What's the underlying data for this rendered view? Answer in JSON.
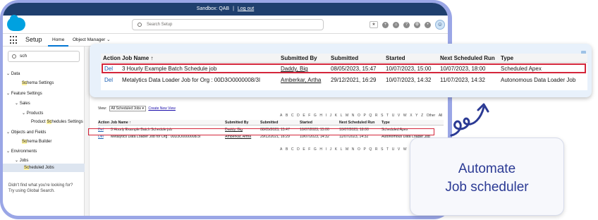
{
  "topbar": {
    "org": "Sandbox: QAB",
    "separator": "|",
    "logout": "Log out"
  },
  "header": {
    "search_placeholder": "Search Setup"
  },
  "nav": {
    "app": "Setup",
    "tabs": [
      "Home",
      "Object Manager"
    ]
  },
  "sidebar": {
    "quickfind_value": "sch",
    "items": [
      {
        "label": "Data"
      },
      {
        "label_pre": "",
        "hl": "Sc",
        "label_post": "hema Settings"
      },
      {
        "label": "Feature Settings"
      },
      {
        "label": "Sales"
      },
      {
        "label": "Products"
      },
      {
        "label_pre": "Product ",
        "hl": "Sc",
        "label_post": "hedules Settings"
      },
      {
        "label": "Objects and Fields"
      },
      {
        "label_pre": "",
        "hl": "Sc",
        "label_post": "hema Builder"
      },
      {
        "label": "Environments"
      },
      {
        "label": "Jobs"
      },
      {
        "label_pre": "",
        "hl": "Sc",
        "label_post": "heduled Jobs"
      }
    ],
    "help_line1": "Didn't find what you're looking for?",
    "help_line2": "Try using Global Search."
  },
  "list": {
    "view_label": "View:",
    "view_value": "All Scheduled Jobs",
    "create_view": "Create New View",
    "alphabet": [
      "A",
      "B",
      "C",
      "D",
      "E",
      "F",
      "G",
      "H",
      "I",
      "J",
      "K",
      "L",
      "M",
      "N",
      "O",
      "P",
      "Q",
      "R",
      "S",
      "T",
      "U",
      "V",
      "W",
      "X",
      "Y",
      "Z",
      "Other",
      "All"
    ],
    "columns": [
      "Action",
      "Job Name ↑",
      "Submitted By",
      "Submitted",
      "Started",
      "Next Scheduled Run",
      "Type"
    ],
    "rows": [
      {
        "action": "Del",
        "job": "3 Hourly Example Batch Schedule job",
        "by": "Daddy, Big",
        "submitted": "08/05/2023, 15:47",
        "started": "10/07/2023, 15:00",
        "next": "10/07/2023, 18:00",
        "type": "Scheduled Apex"
      },
      {
        "action": "Del",
        "job": "Metalytics Data Loader Job for Org : 00D3O0000008/3I",
        "by": "Amberkar, Artha",
        "submitted": "29/12/2021, 16:29",
        "started": "10/07/2023, 14:32",
        "next": "11/07/2023, 14:32",
        "type": "Autonomous Data Loader Job"
      }
    ]
  },
  "callout": {
    "line1": "Automate",
    "line2": "Job scheduler"
  },
  "colors": {
    "accent": "#2b3a94",
    "highlight": "#d4263b",
    "frame": "#9aa6e6",
    "topbar": "#1f3f6e"
  }
}
